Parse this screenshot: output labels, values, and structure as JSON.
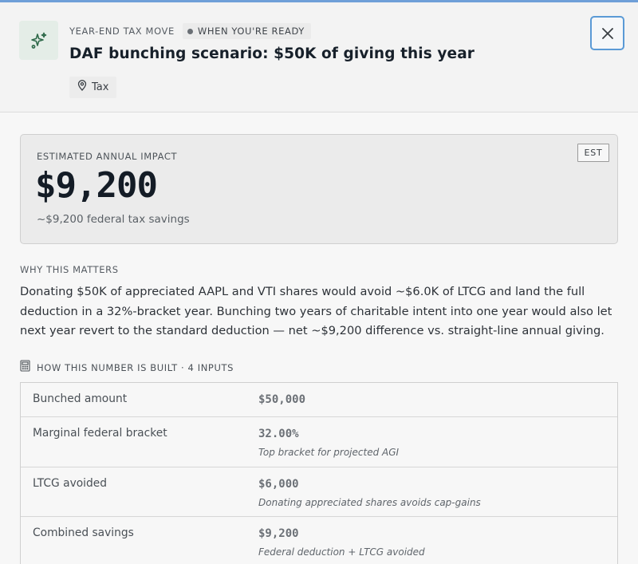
{
  "header": {
    "eyebrow": "Year-end tax move",
    "timing": "When you're ready",
    "title": "DAF bunching scenario: $50K of giving this year",
    "tag": "Tax",
    "icon": "sparkles-icon"
  },
  "impact": {
    "label": "Estimated annual impact",
    "value": "$9,200",
    "subtext": "~$9,200 federal tax savings",
    "badge": "EST"
  },
  "why": {
    "label": "Why this matters",
    "body": "Donating $50K of appreciated AAPL and VTI shares would avoid ~$6.0K of LTCG and land the full deduction in a 32%-bracket year. Bunching two years of charitable intent into one year would also let next year revert to the standard deduction — net ~$9,200 difference vs. straight-line annual giving."
  },
  "built": {
    "label": "How this number is built · 4 inputs",
    "rows": [
      {
        "label": "Bunched amount",
        "value": "$50,000",
        "note": ""
      },
      {
        "label": "Marginal federal bracket",
        "value": "32.00%",
        "note": "Top bracket for projected AGI"
      },
      {
        "label": "LTCG avoided",
        "value": "$6,000",
        "note": "Donating appreciated shares avoids cap-gains"
      },
      {
        "label": "Combined savings",
        "value": "$9,200",
        "note": "Federal deduction + LTCG avoided"
      }
    ]
  },
  "colors": {
    "accent": "#5a9ad6",
    "icon_green": "#2f6a4a",
    "icon_bg": "#e4ede7"
  }
}
